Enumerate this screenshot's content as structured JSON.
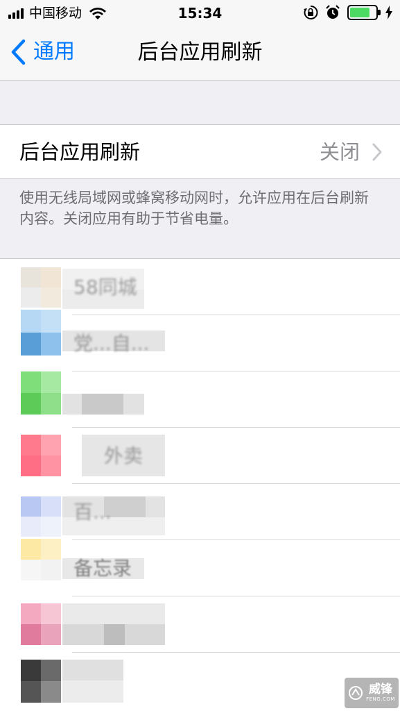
{
  "status_bar": {
    "carrier": "中国移动",
    "time": "15:34",
    "battery_level": 0.78,
    "icons": [
      "signal-icon",
      "wifi-icon",
      "orientation-lock-icon",
      "alarm-icon",
      "battery-icon",
      "charging-bolt-icon"
    ]
  },
  "nav": {
    "back_label": "通用",
    "title": "后台应用刷新"
  },
  "setting": {
    "label": "后台应用刷新",
    "value": "关闭"
  },
  "description": "使用无线局域网或蜂窝移动网时，允许应用在后台刷新内容。关闭应用有助于节省电量。",
  "apps": [
    {
      "name": "58同城"
    },
    {
      "name": "党...自..."
    },
    {
      "name": ""
    },
    {
      "name": "外卖"
    },
    {
      "name": "百..."
    },
    {
      "name": "备忘录"
    },
    {
      "name": ""
    },
    {
      "name": ""
    }
  ],
  "colors": {
    "accent": "#007aff",
    "battery_fill": "#4cd964",
    "secondary_text": "#8e8e93",
    "background": "#efeff4"
  },
  "watermark": {
    "name": "威锋",
    "domain": "FENG.COM"
  }
}
